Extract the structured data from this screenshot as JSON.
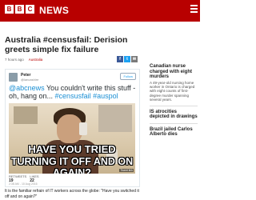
{
  "header": {
    "logo_letters": [
      "B",
      "B",
      "C"
    ],
    "section": "NEWS",
    "menu_icon": "menu-icon",
    "background": "#b80000"
  },
  "article": {
    "headline": "Australia #censusfail: Derision greets simple fix failure",
    "time": "7 hours ago",
    "section": "Australia",
    "share_icons": [
      "facebook-icon",
      "twitter-icon",
      "email-icon"
    ],
    "body_snippet": "It is the familiar refrain of IT workers across the globe: \"Have you switched it off and on again?\""
  },
  "tweet": {
    "user": "Peter",
    "handle": "@lancashire",
    "follow_label": "Follow",
    "text_mention": "@abcnews",
    "text_mid": " You couldn't write this stuff - oh, hang on... ",
    "hashtags": "#censusfail #auspol",
    "meme_line1": "HAVE YOU TRIED",
    "meme_line2": "TURNING IT OFF AND ON AGAIN?",
    "image_credit": "Tweet link",
    "retweets_label": "RETWEETS",
    "retweets": "19",
    "likes_label": "LIKES",
    "likes": "22",
    "timestamp": "2:38 AM - 10 Aug 2016"
  },
  "sidebar": {
    "items": [
      {
        "headline": "Canadian nurse charged with eight murders",
        "desc": "A 49-year-old nursing home worker in Ontario is charged with eight counts of first-degree murder spanning several years."
      },
      {
        "headline": "IS atrocities depicted in drawings",
        "desc": ""
      },
      {
        "headline": "Brazil jailed Carlos Alberto dies",
        "desc": ""
      }
    ]
  }
}
